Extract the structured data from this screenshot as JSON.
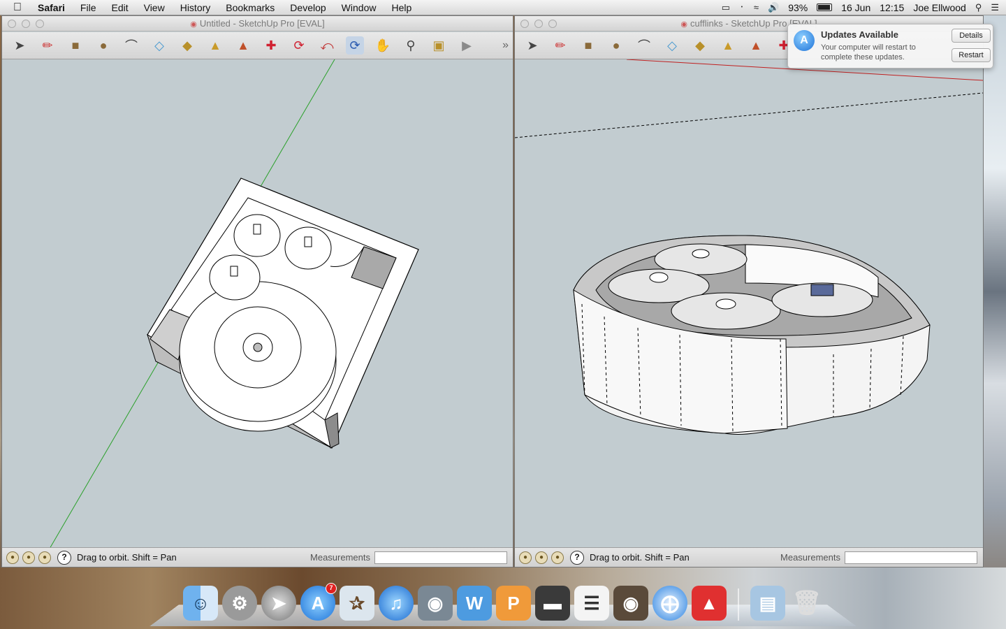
{
  "menubar": {
    "apple": "",
    "app_name": "Safari",
    "items": [
      "File",
      "Edit",
      "View",
      "History",
      "Bookmarks",
      "Develop",
      "Window",
      "Help"
    ],
    "battery": "93%",
    "date": "16 Jun",
    "time": "12:15",
    "user": "Joe Ellwood"
  },
  "windows": {
    "left": {
      "title": "Untitled - SketchUp Pro [EVAL]",
      "status": "Drag to orbit.  Shift = Pan",
      "measurements_label": "Measurements"
    },
    "right": {
      "title": "cufflinks - SketchUp Pro [EVAL]",
      "status": "Drag to orbit.  Shift = Pan",
      "measurements_label": "Measurements"
    }
  },
  "toolbar_icons": [
    "select-icon",
    "pencil-icon",
    "rectangle-icon",
    "circle-icon",
    "arc-icon",
    "eraser-icon",
    "tape-measure-icon",
    "paint-bucket-icon",
    "push-pull-icon",
    "move-icon",
    "rotate-icon",
    "offset-icon",
    "orbit-icon",
    "pan-icon",
    "zoom-icon",
    "zoom-extents-icon",
    "previous-view-icon"
  ],
  "notification": {
    "title": "Updates Available",
    "body": "Your computer will restart to complete these updates.",
    "details_button": "Details",
    "restart_button": "Restart"
  },
  "dock": {
    "app_store_badge": "7"
  }
}
